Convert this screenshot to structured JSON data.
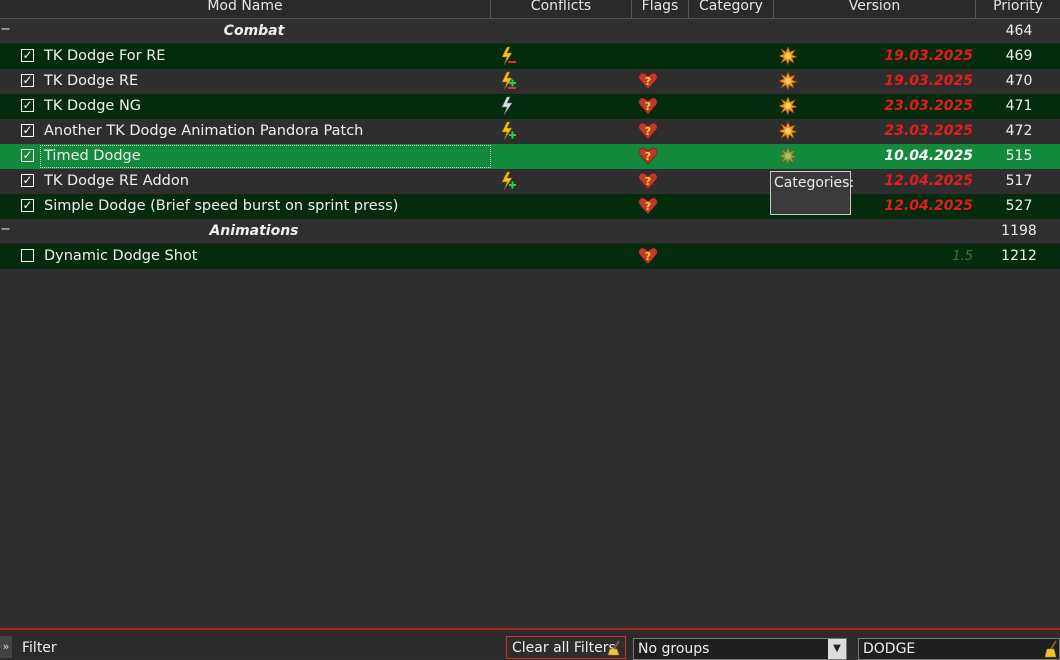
{
  "columns": {
    "mod_name": "Mod Name",
    "conflicts": "Conflicts",
    "flags": "Flags",
    "category": "Category",
    "version": "Version",
    "priority": "Priority"
  },
  "rows": [
    {
      "type": "separator",
      "collapse": "−",
      "name": "Combat",
      "priority": "464"
    },
    {
      "type": "mod",
      "checked": "✓",
      "name": "TK Dodge For RE",
      "conflict_icon": "lightning-overwrite-icon",
      "flag_icon": "",
      "category_icon": "category-badge-icon",
      "version": "19.03.2025",
      "priority": "469"
    },
    {
      "type": "mod",
      "checked": "✓",
      "name": "TK Dodge RE",
      "conflict_icon": "lightning-mixed-icon",
      "flag_icon": "heart-question-icon",
      "category_icon": "category-badge-icon",
      "version": "19.03.2025",
      "priority": "470"
    },
    {
      "type": "mod",
      "checked": "✓",
      "name": "TK Dodge NG",
      "conflict_icon": "lightning-redundant-icon",
      "flag_icon": "heart-question-icon",
      "category_icon": "category-badge-icon",
      "version": "23.03.2025",
      "priority": "471"
    },
    {
      "type": "mod",
      "checked": "✓",
      "name": "Another TK Dodge Animation Pandora Patch",
      "conflict_icon": "lightning-plus-icon",
      "flag_icon": "heart-question-icon",
      "category_icon": "category-badge-icon",
      "version": "23.03.2025",
      "priority": "472"
    },
    {
      "type": "mod",
      "checked": "✓",
      "name": "Timed Dodge",
      "conflict_icon": "",
      "flag_icon": "heart-question-icon",
      "category_icon": "category-badge-icon",
      "version": "10.04.2025",
      "priority": "515",
      "selected": true
    },
    {
      "type": "mod",
      "checked": "✓",
      "name": "TK Dodge RE Addon",
      "conflict_icon": "lightning-plus-icon",
      "flag_icon": "heart-question-icon",
      "category_icon": "",
      "version": "12.04.2025",
      "priority": "517"
    },
    {
      "type": "mod",
      "checked": "✓",
      "name": "Simple Dodge (Brief speed burst on sprint press)",
      "conflict_icon": "",
      "flag_icon": "heart-question-icon",
      "category_icon": "",
      "version": "12.04.2025",
      "priority": "527"
    },
    {
      "type": "separator",
      "collapse": "−",
      "name": "Animations",
      "priority": "1198"
    },
    {
      "type": "mod",
      "checked": "",
      "name": "Dynamic Dodge Shot",
      "conflict_icon": "",
      "flag_icon": "heart-question-icon",
      "category_icon": "",
      "version": "1.5",
      "priority": "1212"
    }
  ],
  "tooltip": {
    "text": "Categories:"
  },
  "bottom_bar": {
    "expand_arrow": "»",
    "filter_label": "Filter",
    "clear_filters": "Clear all Filters",
    "groups_value": "No groups",
    "dropdown_arrow": "▼",
    "search_value": "DODGE"
  },
  "colors": {
    "mod_row_dark": "#052b0f",
    "mod_row_grey": "#2e2e2e",
    "selected_row": "#138a3b",
    "version_red": "#e51c1c",
    "accent_red": "#b22222"
  }
}
